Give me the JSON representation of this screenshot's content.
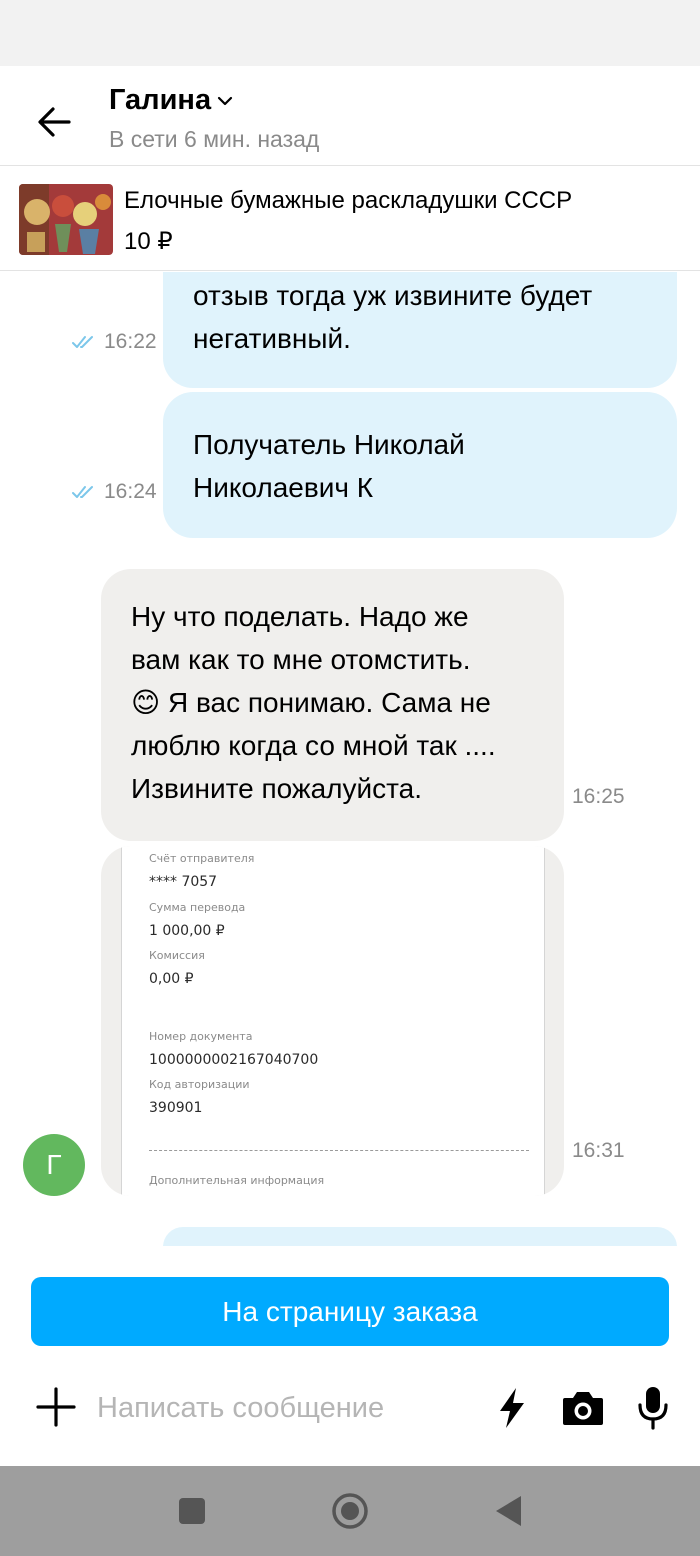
{
  "header": {
    "contact_name": "Галина",
    "contact_status": "В сети 6 мин. назад"
  },
  "product": {
    "title": "Елочные бумажные раскладушки СССР",
    "price": "10 ₽"
  },
  "messages": [
    {
      "direction": "outgoing",
      "lines": [
        "отзыв тогда уж извините будет",
        "негативный."
      ],
      "time": "16:22",
      "status": "read"
    },
    {
      "direction": "outgoing",
      "lines": [
        "Получатель Николай",
        "Николаевич К"
      ],
      "time": "16:24",
      "status": "read"
    },
    {
      "direction": "incoming",
      "lines": [
        "Ну что поделать. Надо же",
        "вам как то мне  отомстить.",
        "😊 Я вас понимаю. Сама  не",
        "люблю когда со мной так ....",
        "Извините пожалуйста."
      ],
      "time": "16:25"
    },
    {
      "direction": "incoming",
      "type": "image",
      "time": "16:31"
    }
  ],
  "receipt": {
    "sender_account_label": "Счёт отправителя",
    "sender_account_value": "**** 7057",
    "amount_label": "Сумма перевода",
    "amount_value": "1 000,00 ₽",
    "fee_label": "Комиссия",
    "fee_value": "0,00 ₽",
    "document_label": "Номер документа",
    "document_value": "1000000002167040700",
    "auth_label": "Код авторизации",
    "auth_value": "390901",
    "extra_label": "Дополнительная информация"
  },
  "avatar": {
    "letter": "Г",
    "color": "#62b85e"
  },
  "bottom": {
    "order_button": "На страницу заказа",
    "input_placeholder": "Написать сообщение"
  },
  "colors": {
    "accent": "#00aaff",
    "outgoing_bubble": "#e0f3fc",
    "incoming_bubble": "#f0efed",
    "read_check": "#7cc7ea"
  },
  "icons": [
    "back-arrow-icon",
    "chevron-down-icon",
    "double-check-icon",
    "plus-icon",
    "lightning-icon",
    "camera-icon",
    "microphone-icon",
    "nav-square-icon",
    "nav-circle-icon",
    "nav-triangle-icon"
  ]
}
